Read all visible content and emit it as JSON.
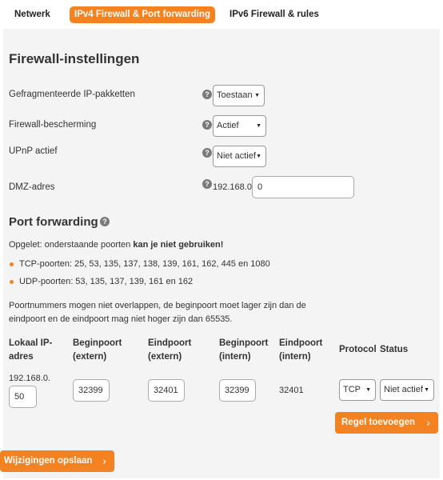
{
  "tabs": [
    {
      "label": "Netwerk"
    },
    {
      "label": "IPv4 Firewall & Port forwarding"
    },
    {
      "label": "IPv6 Firewall & rules"
    }
  ],
  "firewall": {
    "title": "Firewall-instellingen",
    "fields": [
      {
        "label": "Gefragmenteerde IP-pakketten",
        "value": "Toestaan"
      },
      {
        "label": "Firewall-bescherming",
        "value": "Actief"
      },
      {
        "label": "UPnP actief",
        "value": "Niet actief"
      },
      {
        "label": "DMZ-adres",
        "prefix": "192.168.0.",
        "value": "0"
      }
    ]
  },
  "help_icon": "help-icon",
  "port_forwarding": {
    "title": "Port forwarding",
    "note_prefix": "Opgelet: onderstaande poorten ",
    "note_bold": "kan je niet gebruiken!",
    "bullets": [
      "TCP-poorten: 25, 53, 135, 137, 138, 139, 161, 162, 445 en 1080",
      "UDP-poorten: 53, 135, 137, 139, 161 en 162"
    ],
    "info_line1": "Poortnummers mogen niet overlappen, de beginpoort moet lager zijn dan de",
    "info_line2": "eindpoort en de eindpoort mag niet hoger zijn dan 65535.",
    "columns": {
      "local_ip_1": "Lokaal IP-",
      "local_ip_2": "adres",
      "start_ext_1": "Beginpoort",
      "start_ext_2": "(extern)",
      "end_ext_1": "Eindpoort",
      "end_ext_2": "(extern)",
      "start_int_1": "Beginpoort",
      "start_int_2": "(intern)",
      "end_int_1": "Eindpoort",
      "end_int_2": "(intern)",
      "protocol": "Protocol",
      "status": "Status"
    },
    "row": {
      "ip_prefix": "192.168.0.",
      "ip_value": "50",
      "start_ext": "32399",
      "end_ext": "32401",
      "start_int": "32399",
      "end_int": "32401",
      "protocol": "TCP",
      "status": "Niet actief"
    },
    "add_rule_label": "Regel toevoegen"
  },
  "save_label": "Wijzigingen opslaan",
  "colors": {
    "accent": "#f58220",
    "panel": "#f4f4f4",
    "help": "#7a7a7a"
  }
}
